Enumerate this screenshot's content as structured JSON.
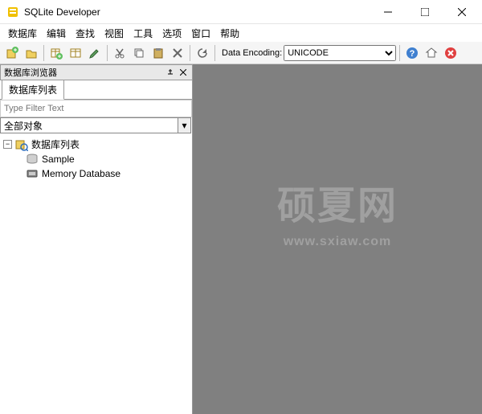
{
  "app": {
    "title": "SQLite Developer"
  },
  "menu": {
    "database": "数据库",
    "edit": "编辑",
    "query": "查找",
    "view": "视图",
    "tool": "工具",
    "option": "选项",
    "window": "窗口",
    "help": "帮助"
  },
  "toolbar": {
    "data_encoding_label": "Data Encoding:",
    "data_encoding_value": "UNICODE"
  },
  "sidebar": {
    "panel_title": "数据库浏览器",
    "tab_label": "数据库列表",
    "filter_placeholder": "Type Filter Text",
    "object_filter": "全部对象",
    "tree": {
      "root_label": "数据库列表",
      "items": [
        {
          "label": "Sample"
        },
        {
          "label": "Memory Database"
        }
      ]
    }
  },
  "watermark": {
    "big": "硕夏网",
    "small": "www.sxiaw.com"
  }
}
